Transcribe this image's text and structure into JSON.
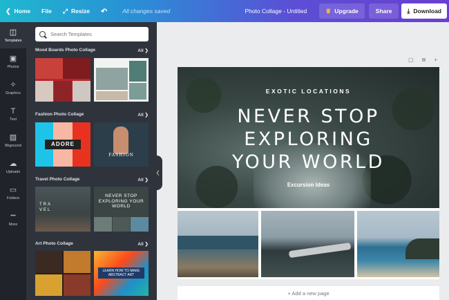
{
  "topbar": {
    "home": "Home",
    "file": "File",
    "resize": "Resize",
    "saved": "All changes saved",
    "title": "Photo Collage - Untitled",
    "upgrade": "Upgrade",
    "share": "Share",
    "download": "Download"
  },
  "rail": [
    {
      "label": "Templates",
      "icon": "templates-icon",
      "glyph": "◫"
    },
    {
      "label": "Photos",
      "icon": "photos-icon",
      "glyph": "▣"
    },
    {
      "label": "Graphics",
      "icon": "graphics-icon",
      "glyph": "✧"
    },
    {
      "label": "Text",
      "icon": "text-icon",
      "glyph": "T"
    },
    {
      "label": "Bkground",
      "icon": "background-icon",
      "glyph": "▨"
    },
    {
      "label": "Uploads",
      "icon": "uploads-icon",
      "glyph": "☁"
    },
    {
      "label": "Folders",
      "icon": "folders-icon",
      "glyph": "▭"
    },
    {
      "label": "More",
      "icon": "more-icon",
      "glyph": "•••"
    }
  ],
  "search": {
    "placeholder": "Search Templates"
  },
  "sections": [
    {
      "title": "Mood Boards Photo Collage",
      "all": "All"
    },
    {
      "title": "Fashion Photo Collage",
      "all": "All"
    },
    {
      "title": "Travel Photo Collage",
      "all": "All"
    },
    {
      "title": "Art Photo Collage",
      "all": "All"
    }
  ],
  "thumbs": {
    "adore": "ADORE",
    "fashion": "FASHION",
    "travel": "TRA VEL",
    "never_stop": "NEVER STOP EXPLORING YOUR WORLD",
    "learn_art": "LEARN HOW TO MAKE ABSTRACT ART"
  },
  "canvas": {
    "subtitle": "EXOTIC LOCATIONS",
    "line1": "NEVER STOP",
    "line2": "EXPLORING",
    "line3": "YOUR WORLD",
    "footer": "Excursion Ideas",
    "add_page": "+ Add a new page"
  }
}
